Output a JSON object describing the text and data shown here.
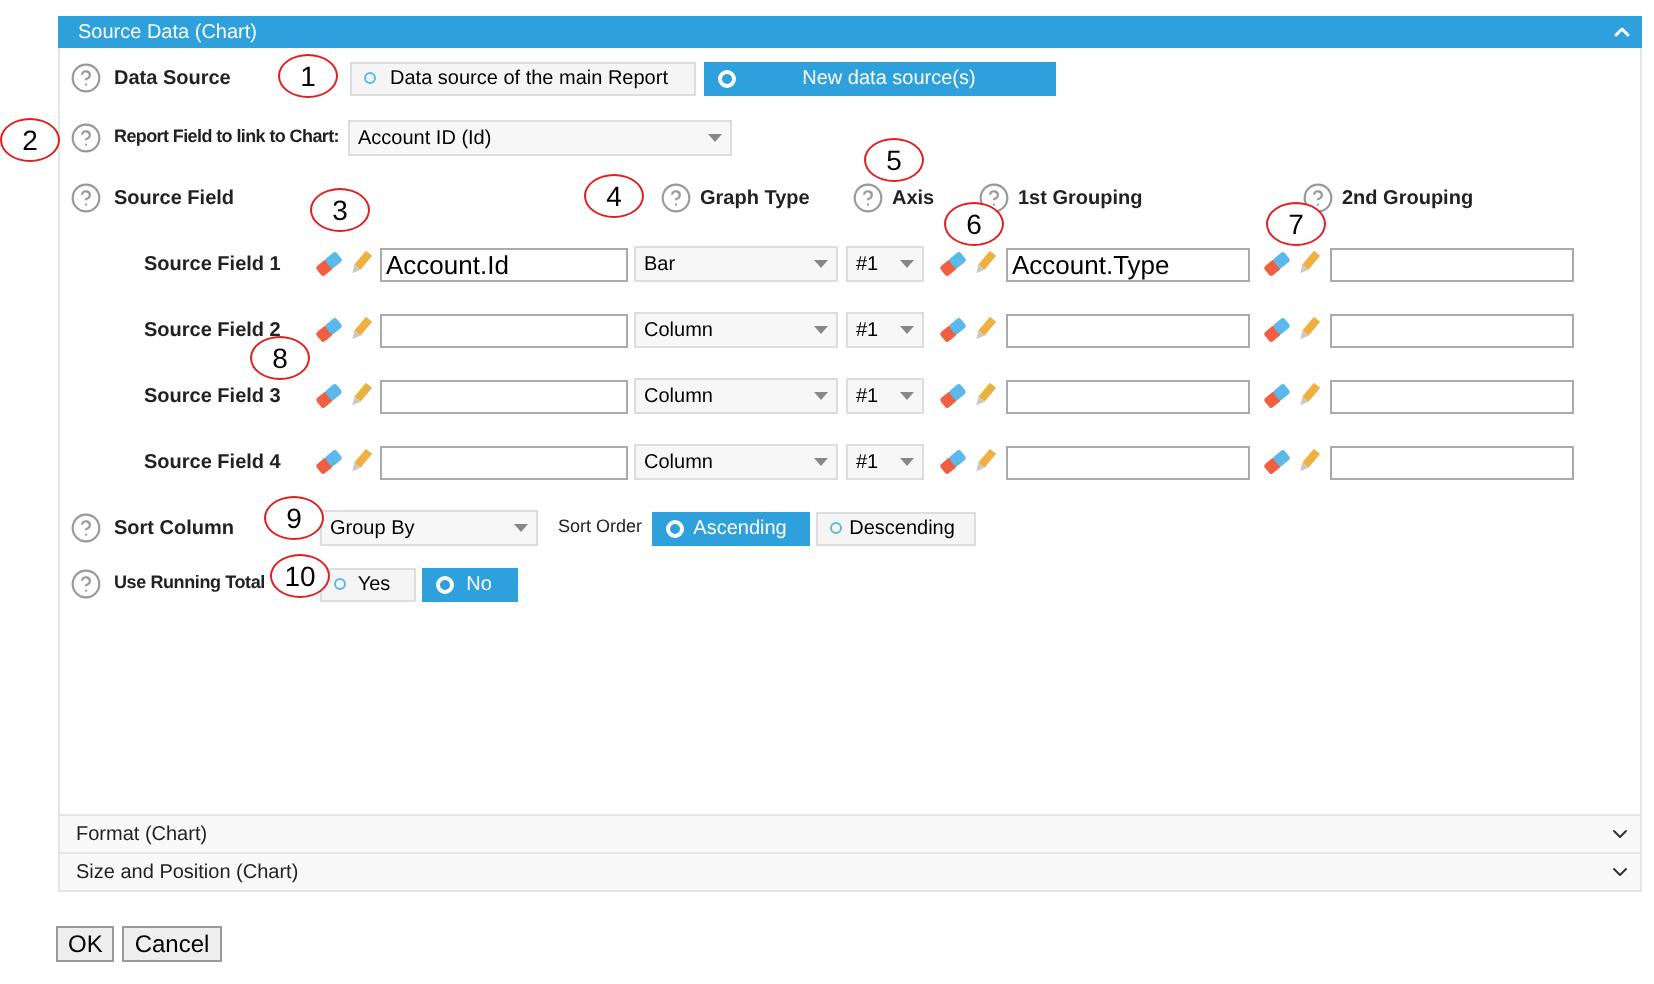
{
  "panel": {
    "title": "Source Data (Chart)",
    "expanded": true
  },
  "data_source": {
    "label": "Data Source",
    "options": [
      {
        "label": "Data source of the main Report",
        "selected": false
      },
      {
        "label": "New data source(s)",
        "selected": true
      }
    ]
  },
  "report_field": {
    "label": "Report Field to link to Chart:",
    "value": "Account ID (Id)"
  },
  "source_fields": {
    "headers": {
      "source_field": "Source Field",
      "graph_type": "Graph Type",
      "axis": "Axis",
      "grouping_1": "1st Grouping",
      "grouping_2": "2nd Grouping"
    },
    "rows": [
      {
        "label": "Source Field 1",
        "field": "Account.Id",
        "graph_type": "Bar",
        "axis": "#1",
        "grouping_1": "Account.Type"
      },
      {
        "label": "Source Field 2",
        "graph_type": "Column",
        "axis": "#1"
      },
      {
        "label": "Source Field 3",
        "graph_type": "Column",
        "axis": "#1"
      },
      {
        "label": "Source Field 4",
        "graph_type": "Column",
        "axis": "#1"
      }
    ]
  },
  "sort": {
    "label": "Sort Column",
    "value": "Group By",
    "order_label": "Sort Order",
    "options": [
      {
        "label": "Ascending",
        "selected": true
      },
      {
        "label": "Descending",
        "selected": false
      }
    ]
  },
  "running_total": {
    "label": "Use Running Total",
    "options": [
      {
        "label": "Yes",
        "selected": false
      },
      {
        "label": "No",
        "selected": true
      }
    ]
  },
  "sections": [
    {
      "title": "Format (Chart)",
      "expanded": false
    },
    {
      "title": "Size and Position (Chart)",
      "expanded": false
    }
  ],
  "buttons": [
    "OK",
    "Cancel"
  ],
  "callouts": [
    "1",
    "2",
    "3",
    "4",
    "5",
    "6",
    "7",
    "8",
    "9",
    "10"
  ]
}
